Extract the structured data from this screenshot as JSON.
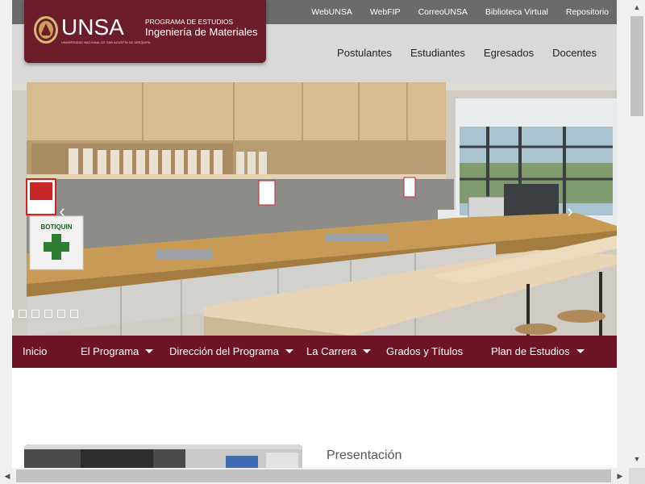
{
  "top_links": [
    "WebUNSA",
    "WebFIP",
    "CorreoUNSA",
    "Biblioteca Virtual",
    "Repositorio"
  ],
  "main_links": [
    "Postulantes",
    "Estudiantes",
    "Egresados",
    "Docentes"
  ],
  "logo": {
    "unsa": "UNSA",
    "unsa_sub": "UNIVERSIDAD NACIONAL DE SAN AGUSTÍN DE AREQUIPA",
    "program_label": "PROGRAMA DE ESTUDIOS",
    "program_name": "Ingeniería de Materiales"
  },
  "hero": {
    "sign_text": "BOTIQUIN",
    "prev": "‹",
    "next": "›",
    "slide_count": 6,
    "active_slide": 1
  },
  "program_nav": [
    {
      "label": "Inicio",
      "dropdown": false
    },
    {
      "label": "El Programa",
      "dropdown": true
    },
    {
      "label": "Dirección del Programa",
      "dropdown": true
    },
    {
      "label": "La Carrera",
      "dropdown": true
    },
    {
      "label": "Grados y Títulos",
      "dropdown": false
    },
    {
      "label": "Plan de Estudios",
      "dropdown": true
    }
  ],
  "content": {
    "section_title": "Presentación"
  },
  "scroll": {
    "up": "▲",
    "down": "▼",
    "left": "◀",
    "right": "▶"
  },
  "colors": {
    "brand": "#6d1c2a",
    "nav": "#6d1425",
    "topbar": "#6b6b6b",
    "mainbar": "#d9d9d9"
  }
}
